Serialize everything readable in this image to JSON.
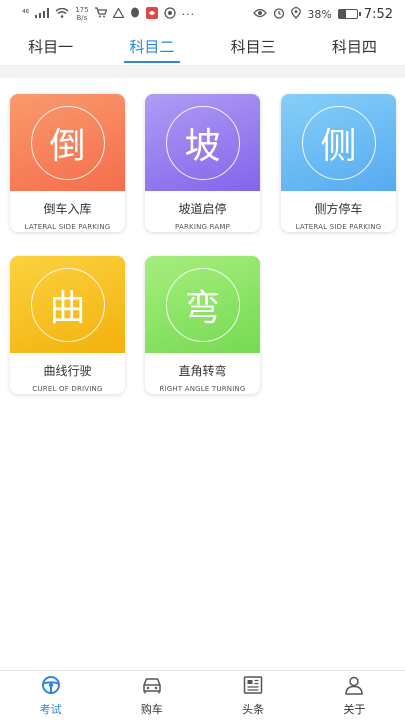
{
  "status_bar": {
    "signal": "⁴⁶",
    "net_speed_value": "175",
    "net_speed_unit": "B/s",
    "battery": "38%",
    "battery_level": 0.38,
    "time": "7:52"
  },
  "tabs": [
    {
      "label": "科目一",
      "active": false
    },
    {
      "label": "科目二",
      "active": true
    },
    {
      "label": "科目三",
      "active": false
    },
    {
      "label": "科目四",
      "active": false
    }
  ],
  "cards": [
    {
      "char": "倒",
      "title": "倒车入库",
      "subtitle": "LATERAL SIDE PARKING"
    },
    {
      "char": "坡",
      "title": "坡道启停",
      "subtitle": "PARKING RAMP"
    },
    {
      "char": "侧",
      "title": "侧方停车",
      "subtitle": "LATERAL SIDE PARKING"
    },
    {
      "char": "曲",
      "title": "曲线行驶",
      "subtitle": "CUREL OF DRIVING"
    },
    {
      "char": "弯",
      "title": "直角转弯",
      "subtitle": "RIGHT ANGLE TURNING"
    }
  ],
  "bottom_nav": [
    {
      "label": "考试",
      "icon": "steering-wheel-icon",
      "active": true
    },
    {
      "label": "购车",
      "icon": "car-icon",
      "active": false
    },
    {
      "label": "头条",
      "icon": "news-icon",
      "active": false
    },
    {
      "label": "关于",
      "icon": "person-icon",
      "active": false
    }
  ],
  "colors": {
    "accent": "#2e86de",
    "card1": "#f56d4d",
    "card2": "#8265ea",
    "card3": "#56aaf0",
    "card4": "#f3b10c",
    "card5": "#76da52"
  }
}
